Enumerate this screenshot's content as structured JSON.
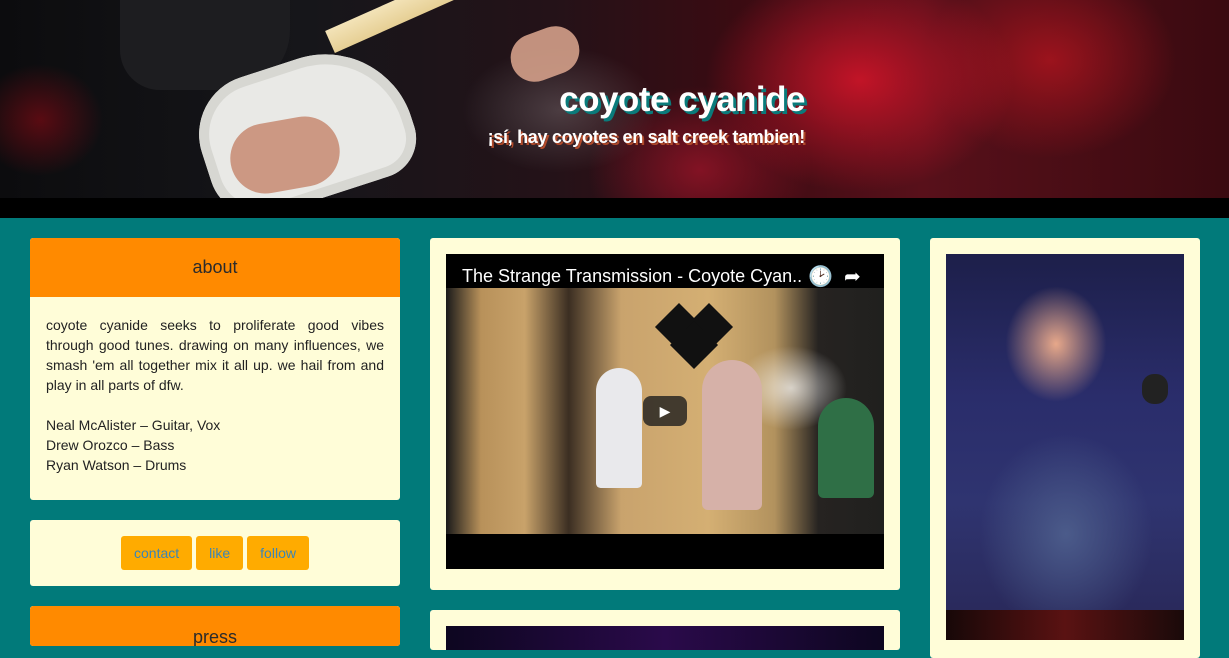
{
  "header": {
    "title": "coyote cyanide",
    "tagline": "¡sí, hay coyotes en salt creek tambien!"
  },
  "about": {
    "heading": "about",
    "description": "coyote cyanide seeks to proliferate good vibes through good tunes. drawing on many influences, we smash 'em all together mix it all up. we hail from and play in all parts of dfw.",
    "members": [
      "Neal McAlister – Guitar, Vox",
      "Drew Orozco – Bass",
      "Ryan Watson – Drums"
    ]
  },
  "links": {
    "contact": "contact",
    "like": "like",
    "follow": "follow"
  },
  "press": {
    "heading": "press"
  },
  "video": {
    "title": "The Strange Transmission - Coyote Cyan...",
    "icons": {
      "clock": "watch-later-icon",
      "share": "share-icon",
      "play": "play-icon"
    }
  },
  "colors": {
    "background": "#017a7a",
    "card": "#fffdd8",
    "header_bar": "#ff8a00",
    "button": "#ffab00",
    "button_text": "#3b85b5"
  }
}
